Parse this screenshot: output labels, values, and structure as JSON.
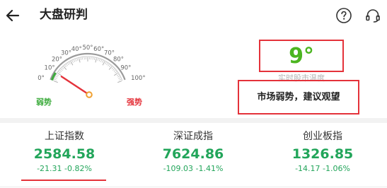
{
  "header": {
    "title": "大盘研判",
    "back_icon": "back-arrow-icon",
    "help_icon": "question-circle-icon",
    "support_icon": "headset-icon"
  },
  "gauge": {
    "ticks": [
      "0°",
      "10°",
      "20°",
      "30°",
      "40°",
      "50°",
      "60°",
      "70°",
      "80°",
      "90°",
      "100°"
    ],
    "weak_label": "弱势",
    "strong_label": "强势",
    "value": 9,
    "colors": {
      "weak": "#3cab3c",
      "strong": "#e4323a",
      "needle": "#e4323a",
      "hub": "#f0a030"
    }
  },
  "temperature": {
    "value": "9°",
    "label": "实时股市温度",
    "advice": "市场弱势，建议观望"
  },
  "indices": [
    {
      "name": "上证指数",
      "value": "2584.58",
      "change": "-21.31  -0.82%"
    },
    {
      "name": "深证成指",
      "value": "7624.86",
      "change": "-109.03  -1.41%"
    },
    {
      "name": "创业板指",
      "value": "1326.85",
      "change": "-14.17  -1.06%"
    }
  ],
  "colors": {
    "down_green": "#22a55a",
    "highlight_red": "#e4323a"
  }
}
